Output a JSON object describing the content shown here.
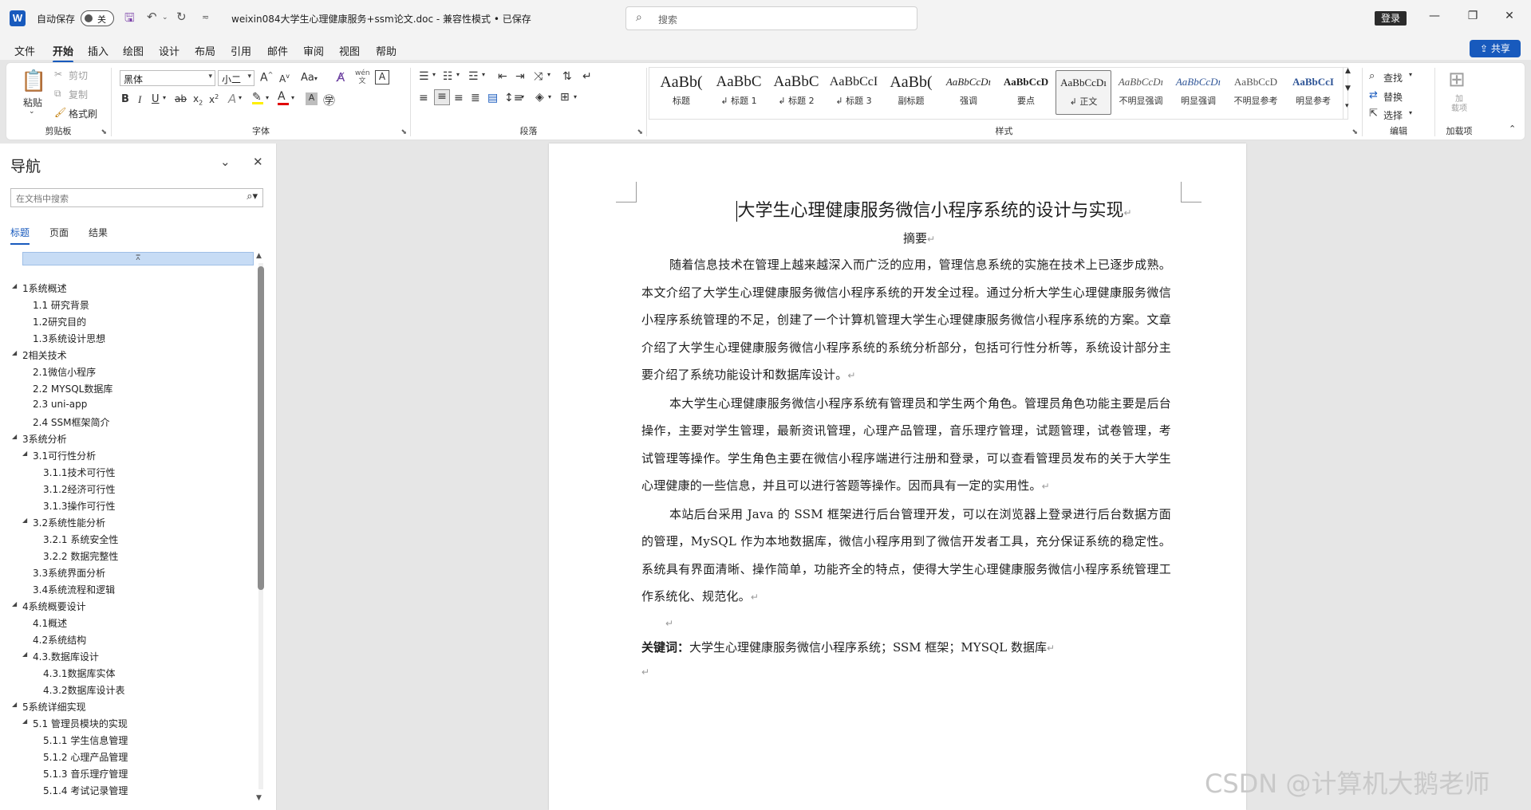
{
  "titlebar": {
    "autosave_label": "自动保存",
    "autosave_state": "关",
    "doc_title": "weixin084大学生心理健康服务+ssm论文.doc  -  兼容性模式 • 已保存",
    "search_placeholder": "搜索",
    "login_label": "登录",
    "save_icon": "save-icon",
    "undo_icon": "undo-icon",
    "redo_icon": "redo-icon"
  },
  "menu": {
    "tabs": [
      "文件",
      "开始",
      "插入",
      "绘图",
      "设计",
      "布局",
      "引用",
      "邮件",
      "审阅",
      "视图",
      "帮助"
    ],
    "active": "开始",
    "share_label": "共享"
  },
  "ribbon": {
    "clipboard": {
      "paste": "粘贴",
      "cut": "剪切",
      "copy": "复制",
      "format_painter": "格式刷",
      "label": "剪贴板"
    },
    "font": {
      "font_name": "黑体",
      "font_size": "小二",
      "label": "字体",
      "case_label": "Aa",
      "clear_icon": "clear-format-icon",
      "wen_label": "wén 文"
    },
    "paragraph": {
      "label": "段落"
    },
    "styles": {
      "label": "样式",
      "items": [
        {
          "sample": "AaBb(",
          "name": "标题"
        },
        {
          "sample": "AaBbC",
          "name": "↲ 标题 1"
        },
        {
          "sample": "AaBbC",
          "name": "↲ 标题 2"
        },
        {
          "sample": "AaBbCcI",
          "name": "↲ 标题 3"
        },
        {
          "sample": "AaBb(",
          "name": "副标题"
        },
        {
          "sample": "AaBbCcDı",
          "name": "强调"
        },
        {
          "sample": "AaBbCcD",
          "name": "要点"
        },
        {
          "sample": "AaBbCcDı",
          "name": "↲ 正文"
        },
        {
          "sample": "AaBbCcDı",
          "name": "不明显强调"
        },
        {
          "sample": "AaBbCcDı",
          "name": "明显强调"
        },
        {
          "sample": "AaBbCcD",
          "name": "不明显参考"
        },
        {
          "sample": "AaBbCcI",
          "name": "明显参考"
        }
      ],
      "selected_index": 7
    },
    "editing": {
      "find": "查找",
      "replace": "替换",
      "select": "选择",
      "label": "编辑"
    },
    "addins": {
      "button": "加\n载项",
      "label": "加载项"
    }
  },
  "nav": {
    "title": "导航",
    "search_placeholder": "在文档中搜索",
    "tabs": [
      "标题",
      "页面",
      "结果"
    ],
    "active_tab": "标题",
    "items": [
      {
        "level": 1,
        "label": "1系统概述",
        "expanded": true
      },
      {
        "level": 2,
        "label": "1.1 研究背景"
      },
      {
        "level": 2,
        "label": "1.2研究目的"
      },
      {
        "level": 2,
        "label": "1.3系统设计思想"
      },
      {
        "level": 1,
        "label": "2相关技术",
        "expanded": true
      },
      {
        "level": 2,
        "label": "2.1微信小程序"
      },
      {
        "level": 2,
        "label": "2.2 MYSQL数据库"
      },
      {
        "level": 2,
        "label": "2.3 uni-app"
      },
      {
        "level": 2,
        "label": "2.4 SSM框架简介"
      },
      {
        "level": 1,
        "label": "3系统分析",
        "expanded": true
      },
      {
        "level": 2,
        "label": "3.1可行性分析",
        "expanded": true
      },
      {
        "level": 3,
        "label": "3.1.1技术可行性"
      },
      {
        "level": 3,
        "label": "3.1.2经济可行性"
      },
      {
        "level": 3,
        "label": "3.1.3操作可行性"
      },
      {
        "level": 2,
        "label": "3.2系统性能分析",
        "expanded": true
      },
      {
        "level": 3,
        "label": "3.2.1 系统安全性"
      },
      {
        "level": 3,
        "label": "3.2.2 数据完整性"
      },
      {
        "level": 2,
        "label": "3.3系统界面分析"
      },
      {
        "level": 2,
        "label": "3.4系统流程和逻辑"
      },
      {
        "level": 1,
        "label": "4系统概要设计",
        "expanded": true
      },
      {
        "level": 2,
        "label": "4.1概述"
      },
      {
        "level": 2,
        "label": "4.2系统结构"
      },
      {
        "level": 2,
        "label": "4.3.数据库设计",
        "expanded": true
      },
      {
        "level": 3,
        "label": "4.3.1数据库实体"
      },
      {
        "level": 3,
        "label": "4.3.2数据库设计表"
      },
      {
        "level": 1,
        "label": "5系统详细实现",
        "expanded": true
      },
      {
        "level": 2,
        "label": "5.1 管理员模块的实现",
        "expanded": true
      },
      {
        "level": 3,
        "label": "5.1.1 学生信息管理"
      },
      {
        "level": 3,
        "label": "5.1.2 心理产品管理"
      },
      {
        "level": 3,
        "label": "5.1.3 音乐理疗管理"
      },
      {
        "level": 3,
        "label": "5.1.4 考试记录管理"
      }
    ]
  },
  "document": {
    "title": "大学生心理健康服务微信小程序系统的设计与实现",
    "abstract_heading": "摘要",
    "paragraphs": [
      "随着信息技术在管理上越来越深入而广泛的应用，管理信息系统的实施在技术上已逐步成熟。本文介绍了大学生心理健康服务微信小程序系统的开发全过程。通过分析大学生心理健康服务微信小程序系统管理的不足，创建了一个计算机管理大学生心理健康服务微信小程序系统的方案。文章介绍了大学生心理健康服务微信小程序系统的系统分析部分，包括可行性分析等，系统设计部分主要介绍了系统功能设计和数据库设计。",
      "本大学生心理健康服务微信小程序系统有管理员和学生两个角色。管理员角色功能主要是后台操作，主要对学生管理，最新资讯管理，心理产品管理，音乐理疗管理，试题管理，试卷管理，考试管理等操作。学生角色主要在微信小程序端进行注册和登录，可以查看管理员发布的关于大学生心理健康的一些信息，并且可以进行答题等操作。因而具有一定的实用性。",
      "本站后台采用 Java 的 SSM 框架进行后台管理开发，可以在浏览器上登录进行后台数据方面的管理，MySQL 作为本地数据库，微信小程序用到了微信开发者工具，充分保证系统的稳定性。系统具有界面清晰、操作简单，功能齐全的特点，使得大学生心理健康服务微信小程序系统管理工作系统化、规范化。"
    ],
    "keywords_label": "关键词：",
    "keywords": "大学生心理健康服务微信小程序系统；SSM 框架；MYSQL 数据库",
    "para_mark": "↵"
  },
  "watermark": "CSDN @计算机大鹅老师"
}
